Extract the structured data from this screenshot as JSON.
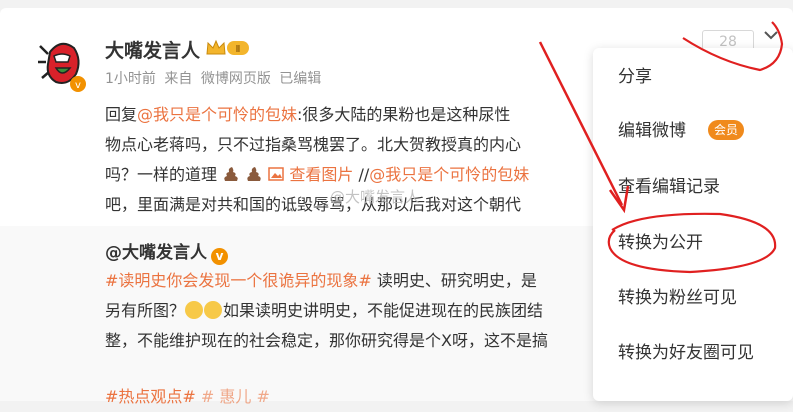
{
  "post": {
    "author": "大嘴发言人",
    "vip_level": "Ⅱ",
    "time": "1小时前",
    "source_prefix": "来自",
    "source": "微博网页版",
    "edited": "已编辑",
    "forward_count": "28",
    "lines": [
      {
        "prefix": "回复",
        "mention": "@我只是个可怜的包妹",
        "text": ":很多大陆的果粉也是这种尿性"
      },
      {
        "text": "物点心老蒋吗，只不过指桑骂槐罢了。北大贺教授真的内心"
      },
      {
        "text": "吗？一样的道理",
        "view_image": "查看图片",
        "sep": "//",
        "mention": "@我只是个可怜的包妹"
      },
      {
        "text": "吧，里面满是对共和国的诋毁辱骂，从那以后我对这个朝代"
      }
    ]
  },
  "quoted": {
    "author": "@大嘴发言人",
    "hashtag1": "#读明史你会发现一个很诡异的现象#",
    "line1_rest": "读明史、研究明史，是",
    "line2_start": "另有所图？",
    "line2_rest": "如果读明史讲明史，不能促进现在的民族团结",
    "line3": "整，不能维护现在的社会稳定，那你研究得是个X呀，这不是搞",
    "line4_hashtag": "#热点观点#",
    "line4_rest": "#                    惠儿 #"
  },
  "watermark": "@大嘴发言人",
  "menu": {
    "items": [
      {
        "label": "分享"
      },
      {
        "label": "编辑微博",
        "tag": "会员"
      },
      {
        "label": "查看编辑记录"
      },
      {
        "label": "转换为公开"
      },
      {
        "label": "转换为粉丝可见"
      },
      {
        "label": "转换为好友圈可见"
      }
    ]
  },
  "colors": {
    "link": "#eb7340",
    "member_tag": "#f08a1c",
    "annotation": "#e02020",
    "verified_badge": "#f29100"
  },
  "icons": [
    "avatar-mascot",
    "vip-crown-icon",
    "chevron-down-icon",
    "poop-emoji",
    "image-icon",
    "thinking-emoji",
    "verified-icon"
  ]
}
